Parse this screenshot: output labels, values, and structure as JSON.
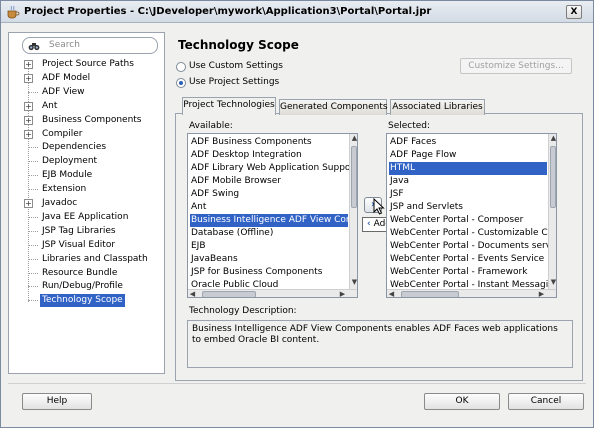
{
  "window": {
    "title": "Project Properties - C:\\JDeveloper\\mywork\\Application3\\Portal\\Portal.jpr",
    "close_label": "X"
  },
  "search": {
    "placeholder": "Search"
  },
  "tree": {
    "items": [
      {
        "label": "Project Source Paths",
        "expandable": true
      },
      {
        "label": "ADF Model",
        "expandable": true
      },
      {
        "label": "ADF View",
        "expandable": false
      },
      {
        "label": "Ant",
        "expandable": true
      },
      {
        "label": "Business Components",
        "expandable": true
      },
      {
        "label": "Compiler",
        "expandable": true
      },
      {
        "label": "Dependencies",
        "expandable": false
      },
      {
        "label": "Deployment",
        "expandable": false
      },
      {
        "label": "EJB Module",
        "expandable": false
      },
      {
        "label": "Extension",
        "expandable": false
      },
      {
        "label": "Javadoc",
        "expandable": true
      },
      {
        "label": "Java EE Application",
        "expandable": false
      },
      {
        "label": "JSP Tag Libraries",
        "expandable": false
      },
      {
        "label": "JSP Visual Editor",
        "expandable": false
      },
      {
        "label": "Libraries and Classpath",
        "expandable": false
      },
      {
        "label": "Resource Bundle",
        "expandable": false
      },
      {
        "label": "Run/Debug/Profile",
        "expandable": false
      },
      {
        "label": "Technology Scope",
        "expandable": false,
        "selected": true
      }
    ]
  },
  "main": {
    "heading": "Technology Scope",
    "radio_custom": "Use Custom Settings",
    "radio_project": "Use Project Settings",
    "customize_button": "Customize Settings...",
    "tabs": [
      {
        "label": "Project Technologies",
        "active": true
      },
      {
        "label": "Generated Components",
        "active": false
      },
      {
        "label": "Associated Libraries",
        "active": false
      }
    ],
    "available_label": "Available:",
    "selected_label": "Selected:",
    "available": [
      "ADF Business Components",
      "ADF Desktop Integration",
      "ADF Library Web Application Support",
      "ADF Mobile Browser",
      "ADF Swing",
      "Ant",
      "Business Intelligence ADF View Components",
      "Database (Offline)",
      "EJB",
      "JavaBeans",
      "JSP for Business Components",
      "Oracle Public Cloud"
    ],
    "available_selected_index": 6,
    "selected": [
      "ADF Faces",
      "ADF Page Flow",
      "HTML",
      "Java",
      "JSF",
      "JSP and Servlets",
      "WebCenter Portal - Composer",
      "WebCenter Portal - Customizable Components",
      "WebCenter Portal - Documents service",
      "WebCenter Portal - Events Service",
      "WebCenter Portal - Framework",
      "WebCenter Portal - Instant Messaging and Presence"
    ],
    "selected_selected_index": 2,
    "move_right_glyph": "›",
    "move_left_glyph": "‹",
    "tooltip": "Add (ALT-D)",
    "description_label": "Technology Description:",
    "description_text": "Business Intelligence ADF View Components enables ADF Faces web applications to embed Oracle BI content."
  },
  "footer": {
    "help": "Help",
    "ok": "OK",
    "cancel": "Cancel"
  },
  "colors": {
    "selection": "#3163c6",
    "accent": "#2a5fb4"
  }
}
